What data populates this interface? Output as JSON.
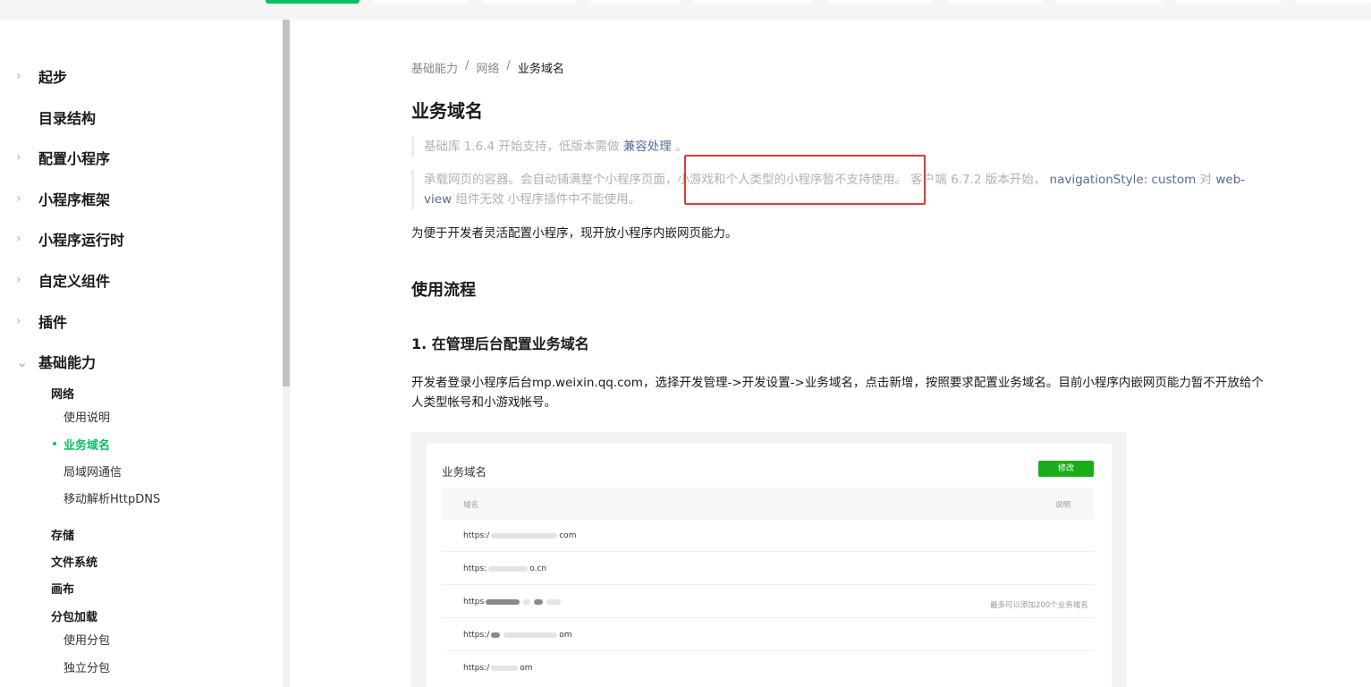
{
  "sidebar": {
    "l1": [
      {
        "label": "起步",
        "chevron": "›"
      },
      {
        "label": "目录结构",
        "chevron": ""
      },
      {
        "label": "配置小程序",
        "chevron": "›"
      },
      {
        "label": "小程序框架",
        "chevron": "›"
      },
      {
        "label": "小程序运行时",
        "chevron": "›"
      },
      {
        "label": "自定义组件",
        "chevron": "›"
      },
      {
        "label": "插件",
        "chevron": "›"
      },
      {
        "label": "基础能力",
        "chevron": "⌄"
      }
    ],
    "network": "网络",
    "network_items": [
      "使用说明",
      "业务域名",
      "局域网通信",
      "移动解析HttpDNS"
    ],
    "storage": "存储",
    "filesystem": "文件系统",
    "canvas": "画布",
    "subpackage": "分包加载",
    "subpackage_items": [
      "使用分包",
      "独立分包"
    ]
  },
  "breadcrumb": {
    "items": [
      "基础能力",
      "网络",
      "业务域名"
    ],
    "separator": "/"
  },
  "page": {
    "title": "业务域名",
    "note1": {
      "text": "基础库 1.6.4 开始支持，低版本需做 ",
      "link": "兼容处理",
      "after": " 。"
    },
    "note2": {
      "part1": "承载网页的容器。会自动铺满整个小程序页面，",
      "part2": "小游戏和个人类型的小程序暂不支持使用。",
      "part3": " 客户端 6.7.2 版本开始， ",
      "code1": "navigationStyle: custom",
      "part4": " 对 ",
      "code2": "web-view",
      "part5": " 组件无效 小程序插件中不能使用。"
    },
    "intro": "为便于开发者灵活配置小程序，现开放小程序内嵌网页能力。",
    "section_title": "使用流程",
    "step1_title": "1. 在管理后台配置业务域名",
    "step1_text": "开发者登录小程序后台mp.weixin.qq.com，选择开发管理->开发设置->业务域名，点击新增，按照要求配置业务域名。目前小程序内嵌网页能力暂不开放给个人类型帐号和小游戏帐号。"
  },
  "screenshot": {
    "title": "业务域名",
    "edit_button": "修改",
    "col_domain": "域名",
    "col_desc": "说明",
    "rows": [
      "https:/",
      "https:",
      "https",
      "https:/",
      "https:/"
    ],
    "row_suffixes": [
      "com",
      "o.cn",
      "",
      "om",
      "om"
    ],
    "limit_note": "最多可以添加200个业务域名"
  },
  "colors": {
    "accent": "#07c160",
    "link": "#576b95",
    "highlight": "#e53935"
  }
}
